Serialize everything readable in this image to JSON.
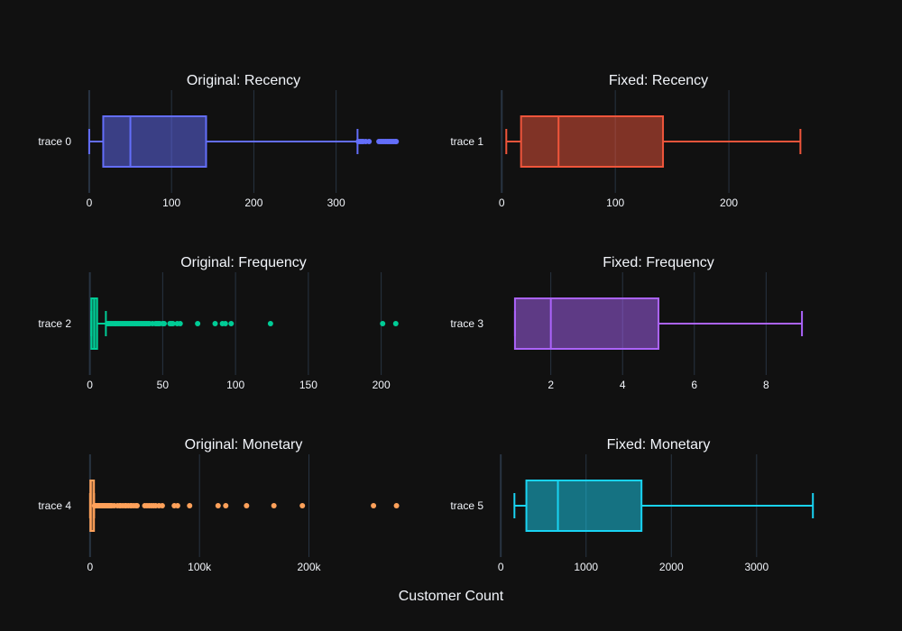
{
  "figure": {
    "background": "#111111",
    "x_axis_title": "Customer Count",
    "grid_color": "#283442",
    "text_color": "#f2f5fa"
  },
  "chart_data": [
    {
      "type": "box",
      "title": "Original: Recency",
      "trace": "trace 0",
      "color": "#636efa",
      "fill": "rgba(99,110,250,0.5)",
      "xlim": [
        -1,
        376
      ],
      "xticks": [
        0,
        100,
        200,
        300
      ],
      "xticklabels": [
        "0",
        "100",
        "200",
        "300"
      ],
      "min": 0,
      "q1": 17,
      "median": 50,
      "q3": 142,
      "upper_fence": 326,
      "outliers": [
        327,
        329,
        331,
        333,
        336,
        340,
        352,
        354,
        356,
        358,
        360,
        362,
        364,
        366,
        368,
        370,
        372,
        373
      ]
    },
    {
      "type": "box",
      "title": "Fixed: Recency",
      "trace": "trace 1",
      "color": "#ef553b",
      "fill": "rgba(239,85,59,0.5)",
      "xlim": [
        -1,
        277
      ],
      "xticks": [
        0,
        100,
        200
      ],
      "xticklabels": [
        "0",
        "100",
        "200"
      ],
      "min": 4,
      "q1": 17,
      "median": 50,
      "q3": 142,
      "upper_fence": 263,
      "outliers": []
    },
    {
      "type": "box",
      "title": "Original: Frequency",
      "trace": "trace 2",
      "color": "#00cc96",
      "fill": "rgba(0,204,150,0.5)",
      "xlim": [
        -1,
        212
      ],
      "xticks": [
        0,
        50,
        100,
        150,
        200
      ],
      "xticklabels": [
        "0",
        "50",
        "100",
        "150",
        "200"
      ],
      "min": 1,
      "q1": 1,
      "median": 3,
      "q3": 5,
      "upper_fence": 11,
      "outliers": [
        12,
        13,
        14,
        15,
        16,
        17,
        18,
        19,
        20,
        21,
        22,
        23,
        24,
        25,
        26,
        27,
        28,
        29,
        30,
        31,
        32,
        33,
        34,
        35,
        36,
        37,
        38,
        39,
        40,
        41,
        43,
        45,
        46,
        47,
        48,
        50,
        51,
        55,
        56,
        57,
        60,
        62,
        74,
        86,
        91,
        93,
        97,
        124,
        201,
        210
      ]
    },
    {
      "type": "box",
      "title": "Fixed: Frequency",
      "trace": "trace 3",
      "color": "#ab63fa",
      "fill": "rgba(171,99,250,0.5)",
      "xlim": [
        0.6,
        9.4
      ],
      "xticks": [
        2,
        4,
        6,
        8
      ],
      "xticklabels": [
        "2",
        "4",
        "6",
        "8"
      ],
      "min": 1,
      "q1": 1,
      "median": 2,
      "q3": 5,
      "upper_fence": 9,
      "outliers": []
    },
    {
      "type": "box",
      "title": "Original: Monetary",
      "trace": "trace 4",
      "color": "#ffa15a",
      "fill": "rgba(255,161,90,0.5)",
      "xlim": [
        -1500,
        282000
      ],
      "xticks": [
        0,
        100000,
        200000
      ],
      "xticklabels": [
        "0",
        "100k",
        "200k"
      ],
      "min": 0,
      "q1": 300,
      "median": 670,
      "q3": 1650,
      "upper_fence": 3700,
      "outliers": [
        4200,
        5000,
        6000,
        7000,
        8000,
        9000,
        10000,
        11000,
        12000,
        13000,
        14000,
        15000,
        16000,
        17000,
        18000,
        19000,
        20000,
        22000,
        25000,
        27000,
        28000,
        30000,
        32000,
        33000,
        35000,
        37000,
        38000,
        40000,
        42000,
        43000,
        50000,
        52000,
        54000,
        56000,
        58000,
        60000,
        63000,
        66000,
        77000,
        80000,
        91000,
        117000,
        124000,
        143000,
        168000,
        194000,
        259000,
        280000
      ]
    },
    {
      "type": "box",
      "title": "Fixed: Monetary",
      "trace": "trace 5",
      "color": "#19d3f3",
      "fill": "rgba(25,211,243,0.5)",
      "xlim": [
        -2,
        3700
      ],
      "xticks": [
        0,
        1000,
        2000,
        3000
      ],
      "xticklabels": [
        "0",
        "1000",
        "2000",
        "3000"
      ],
      "min": 160,
      "q1": 300,
      "median": 670,
      "q3": 1650,
      "upper_fence": 3660,
      "outliers": []
    }
  ]
}
